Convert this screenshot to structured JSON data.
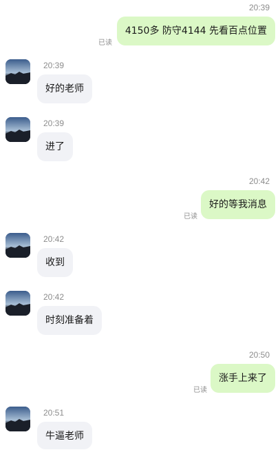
{
  "read_label": "已读",
  "messages": [
    {
      "dir": "out",
      "time": "20:39",
      "text": "4150多  防守4144  先看百点位置",
      "read": "已读"
    },
    {
      "dir": "in",
      "time": "20:39",
      "text": "好的老师"
    },
    {
      "dir": "in",
      "time": "20:39",
      "text": "进了"
    },
    {
      "dir": "out",
      "time": "20:42",
      "text": "好的等我消息",
      "read": "已读"
    },
    {
      "dir": "in",
      "time": "20:42",
      "text": "收到"
    },
    {
      "dir": "in",
      "time": "20:42",
      "text": "时刻准备着"
    },
    {
      "dir": "out",
      "time": "20:50",
      "text": "涨手上来了",
      "read": "已读"
    },
    {
      "dir": "in",
      "time": "20:51",
      "text": "牛逼老师"
    }
  ],
  "colors": {
    "outgoing_bubble": "#dbf8c6",
    "incoming_bubble": "#f1f2f6",
    "meta_text": "#8c8c8c"
  }
}
